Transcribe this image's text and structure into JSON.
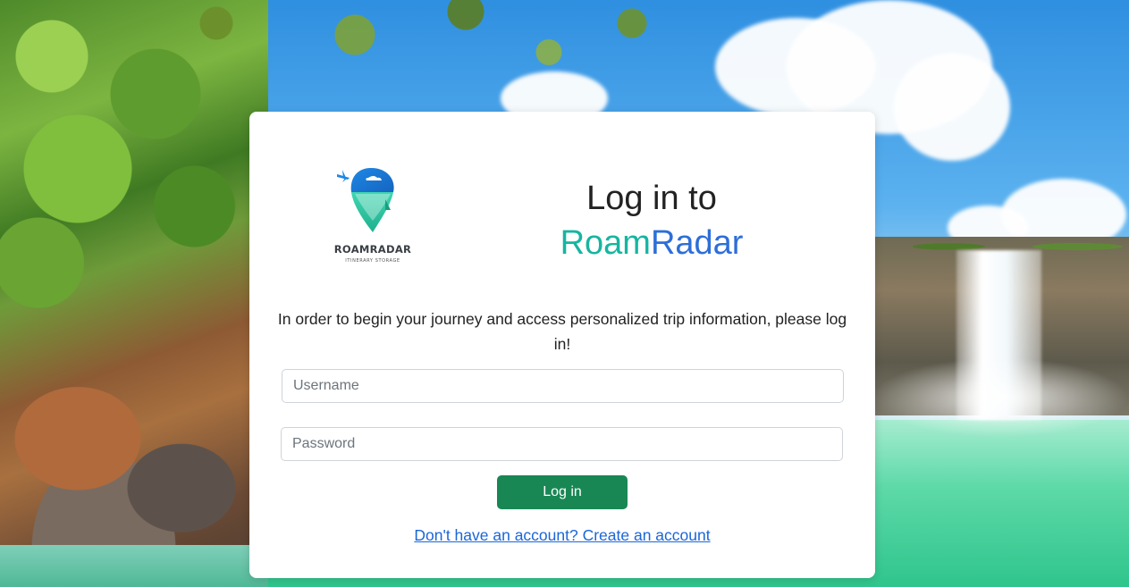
{
  "logo": {
    "name": "ROAMRADAR",
    "tagline": "ITINERARY STORAGE",
    "icon": "map-pin-plane-icon"
  },
  "heading": {
    "line1": "Log in to",
    "brand_part1": "Roam",
    "brand_part2": "Radar"
  },
  "intro_text": "In order to begin your journey and access personalized trip information, please log in!",
  "form": {
    "username_placeholder": "Username",
    "username_value": "",
    "password_placeholder": "Password",
    "password_value": "",
    "submit_label": "Log in"
  },
  "signup_link": "Don't have an account? Create an account",
  "colors": {
    "brand_teal": "#17b5a0",
    "brand_blue": "#2d6fd8",
    "button_green": "#198754",
    "link_blue": "#1a66d9"
  }
}
